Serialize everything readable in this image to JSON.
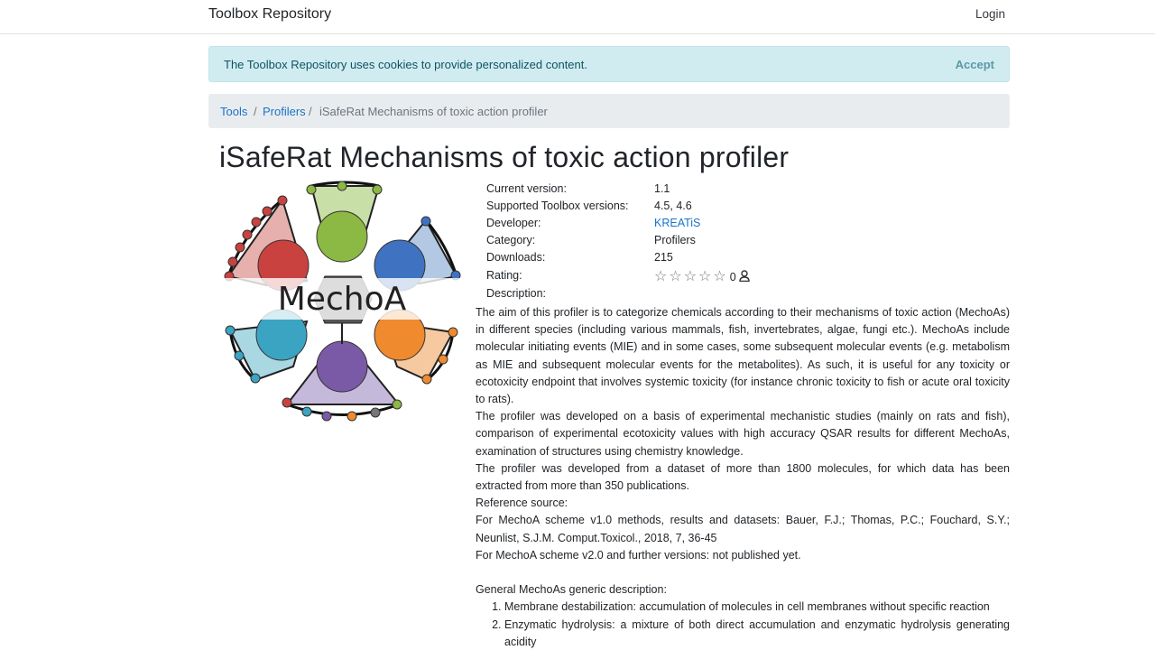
{
  "navbar": {
    "brand": "Toolbox Repository",
    "login": "Login"
  },
  "cookie_banner": {
    "text": "The Toolbox Repository uses cookies to provide personalized content.",
    "accept": "Accept"
  },
  "breadcrumb": {
    "items": [
      "Tools",
      "Profilers"
    ],
    "active": "iSafeRat Mechanisms of toxic action profiler",
    "separator": "/"
  },
  "page_title": "iSafeRat Mechanisms of toxic action profiler",
  "logo": {
    "text": "MechoA"
  },
  "metadata": {
    "current_version_label": "Current version:",
    "current_version": "1.1",
    "supported_label": "Supported Toolbox versions:",
    "supported": "4.5, 4.6",
    "developer_label": "Developer:",
    "developer": "KREATiS",
    "category_label": "Category:",
    "category": "Profilers",
    "downloads_label": "Downloads:",
    "downloads": "215",
    "rating_label": "Rating:",
    "rating_count": "0",
    "rating_stars": 0,
    "description_label": "Description:"
  },
  "description": {
    "p1": "The aim of this profiler is to categorize chemicals according to their mechanisms of toxic action (MechoAs) in different species (including various mammals, fish, invertebrates, algae, fungi etc.). MechoAs include molecular initiating events (MIE) and in some cases, some subsequent molecular events (e.g. metabolism as MIE and subsequent molecular events for the metabolites). As such, it is useful for any toxicity or ecotoxicity endpoint that involves systemic toxicity (for instance chronic toxicity to fish or acute oral toxicity to rats).",
    "p2": "The profiler was developed on a basis of experimental mechanistic studies (mainly on rats and fish), comparison of experimental ecotoxicity values with high accuracy QSAR results for different MechoAs, examination of structures using chemistry knowledge.",
    "p3": "The profiler was developed from a dataset of more than 1800 molecules, for which data has been extracted from more than 350 publications.",
    "p4": "Reference source:",
    "p5": "For MechoA scheme v1.0 methods, results and datasets: Bauer, F.J.; Thomas, P.C.; Fouchard, S.Y.; Neunlist, S.J.M. Comput.Toxicol., 2018, 7, 36-45",
    "p6": "For MechoA scheme v2.0 and further versions: not published yet.",
    "p7": "General MechoAs generic description:",
    "list": [
      "Membrane destabilization: accumulation of molecules in cell membranes without specific reaction",
      "Enzymatic hydrolysis: a mixture of both direct accumulation and enzymatic hydrolysis generating acidity"
    ]
  },
  "colors": {
    "link": "#1a73c7",
    "cookie_bg": "#d1ecf1",
    "breadcrumb_bg": "#e9ecef"
  }
}
